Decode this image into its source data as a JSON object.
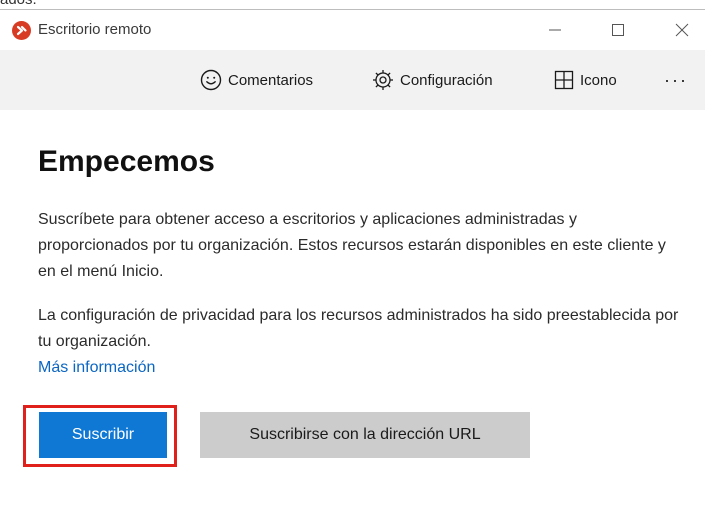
{
  "window": {
    "title": "Escritorio remoto",
    "background_text_fragment": "ados."
  },
  "toolbar": {
    "feedback_label": "Comentarios",
    "settings_label": "Configuración",
    "view_label": "Icono",
    "more_label": "···"
  },
  "main": {
    "title": "Empecemos",
    "description": "Suscríbete para obtener acceso a escritorios y aplicaciones administradas y proporcionados por tu organización. Estos recursos estarán disponibles en este cliente y en el menú Inicio.",
    "privacy_text": "La configuración de privacidad para los recursos administrados ha sido preestablecida por tu organización.",
    "more_info_link": "Más información",
    "subscribe_label": "Suscribir",
    "subscribe_url_label": "Suscribirse con la dirección URL"
  },
  "colors": {
    "accent": "#0e78d4",
    "secondary_button": "#cccccc",
    "toolbar_bg": "#f2f2f2",
    "link": "#0a66c2",
    "highlight": "#e0201b",
    "app_icon": "#d83b23"
  },
  "icons": {
    "app": "remote-desktop-icon",
    "feedback": "smiley-icon",
    "settings": "gear-icon",
    "view": "grid-icon",
    "minimize": "minimize-icon",
    "maximize": "maximize-icon",
    "close": "close-icon"
  }
}
